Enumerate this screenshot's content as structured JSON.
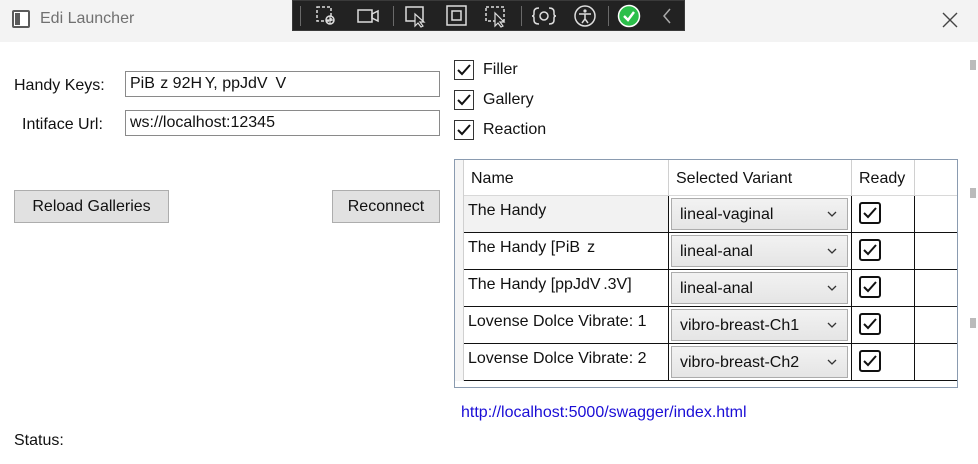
{
  "window": {
    "title": "Edi Launcher",
    "icon": "window-app-icon",
    "close_icon": "close-icon"
  },
  "devtools": {
    "tools": [
      "select-element-icon",
      "record-icon",
      "pointer-select-icon",
      "frame-icon",
      "track-focus-icon",
      "binding-icon",
      "accessibility-icon",
      "check-circle-icon",
      "collapse-chevron-icon"
    ],
    "check_color": "#2bbf4a"
  },
  "form": {
    "handy_keys_label": "Handy Keys:",
    "handy_keys_value": "PiB  z 92H Y, ppJdV   V",
    "intiface_label": "Intiface Url:",
    "intiface_value": "ws://localhost:12345",
    "reload_button": "Reload Galleries",
    "reconnect_button": "Reconnect",
    "status_label": "Status:"
  },
  "options": [
    {
      "label": "Filler",
      "checked": true
    },
    {
      "label": "Gallery",
      "checked": true
    },
    {
      "label": "Reaction",
      "checked": true
    }
  ],
  "grid": {
    "columns": [
      "Name",
      "Selected Variant",
      "Ready"
    ],
    "rows": [
      {
        "name": "The Handy",
        "variant": "lineal-vaginal",
        "ready": true
      },
      {
        "name": "The Handy [PiB  z",
        "variant": "lineal-anal",
        "ready": true
      },
      {
        "name": "The Handy [ppJdV .3V]",
        "variant": "lineal-anal",
        "ready": true
      },
      {
        "name": "Lovense Dolce Vibrate: 1",
        "variant": "vibro-breast-Ch1",
        "ready": true
      },
      {
        "name": "Lovense Dolce Vibrate: 2",
        "variant": "vibro-breast-Ch2",
        "ready": true
      }
    ]
  },
  "swagger_link": "http://localhost:5000/swagger/index.html"
}
